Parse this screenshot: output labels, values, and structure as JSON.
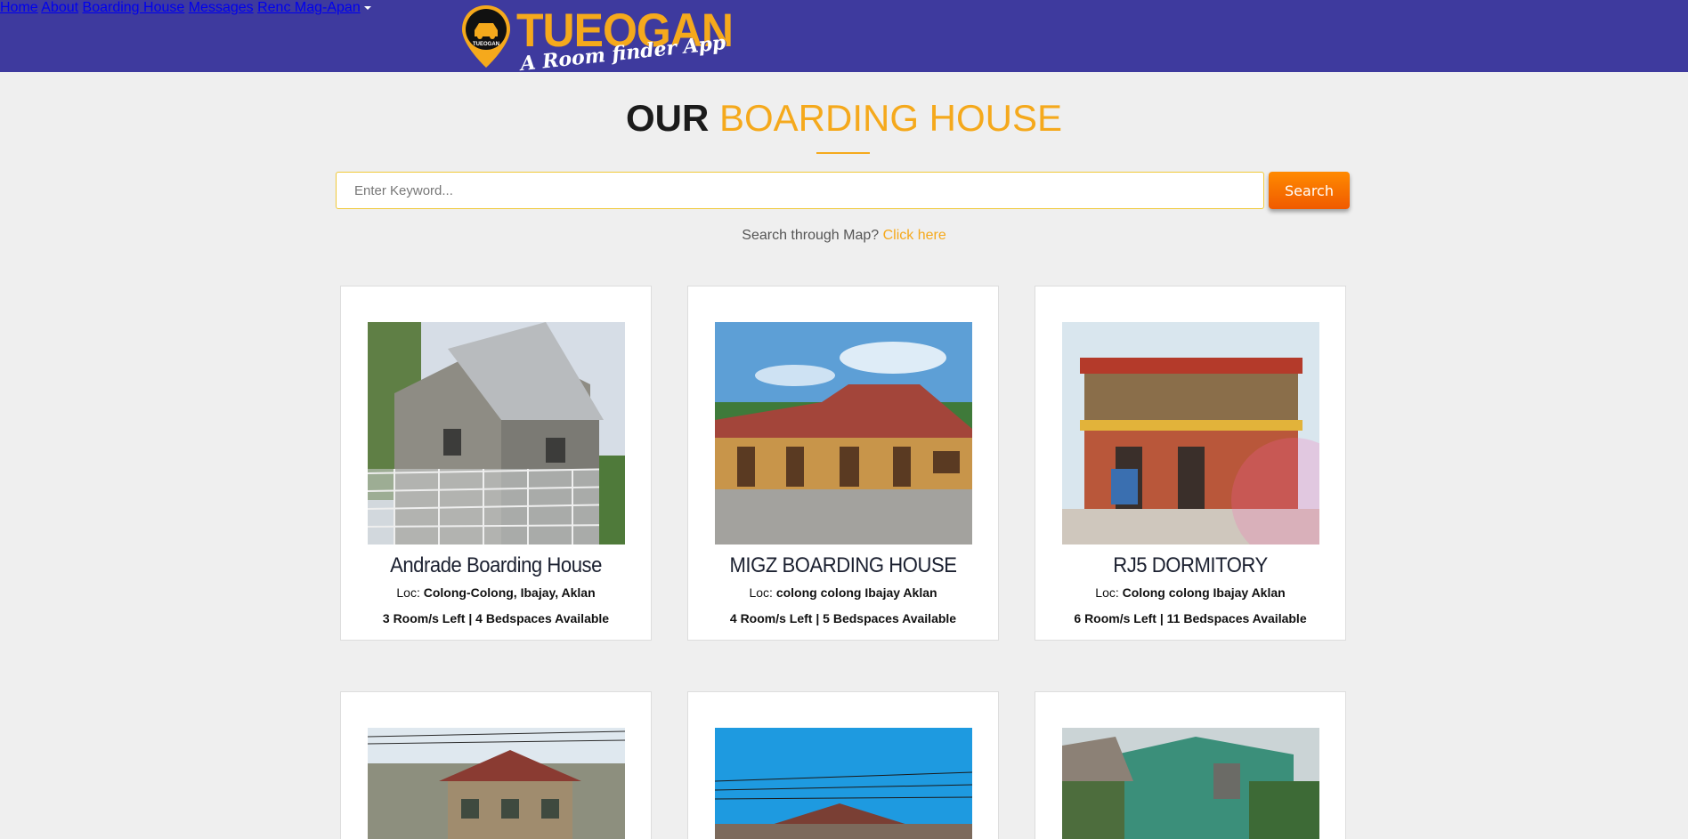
{
  "brand": {
    "name": "TUEOGAN",
    "tagline": "A Room finder App",
    "badge_text": "TUEOGAN",
    "primary_color": "#3e3a9e",
    "accent_color": "#f5a91c"
  },
  "nav": {
    "items": [
      {
        "label": "Home"
      },
      {
        "label": "About"
      },
      {
        "label": "Boarding House"
      },
      {
        "label": "Messages"
      },
      {
        "label": "Renc Mag-Apan",
        "dropdown": true
      }
    ]
  },
  "heading": {
    "word1": "OUR",
    "word2": "BOARDING HOUSE"
  },
  "search": {
    "placeholder": "Enter Keyword...",
    "value": "",
    "button_label": "Search",
    "map_prompt": "Search through Map?",
    "map_link": "Click here"
  },
  "cards": [
    {
      "name": "Andrade Boarding House",
      "loc_label": "Loc:",
      "location": "Colong-Colong, Ibajay, Aklan",
      "availability": "3 Room/s Left | 4 Bedspaces Available"
    },
    {
      "name": "MIGZ BOARDING HOUSE",
      "loc_label": "Loc:",
      "location": "colong colong Ibajay Aklan",
      "availability": "4 Room/s Left | 5 Bedspaces Available"
    },
    {
      "name": "RJ5 DORMITORY",
      "loc_label": "Loc:",
      "location": "Colong colong Ibajay Aklan",
      "availability": "6 Room/s Left | 11 Bedspaces Available"
    }
  ]
}
